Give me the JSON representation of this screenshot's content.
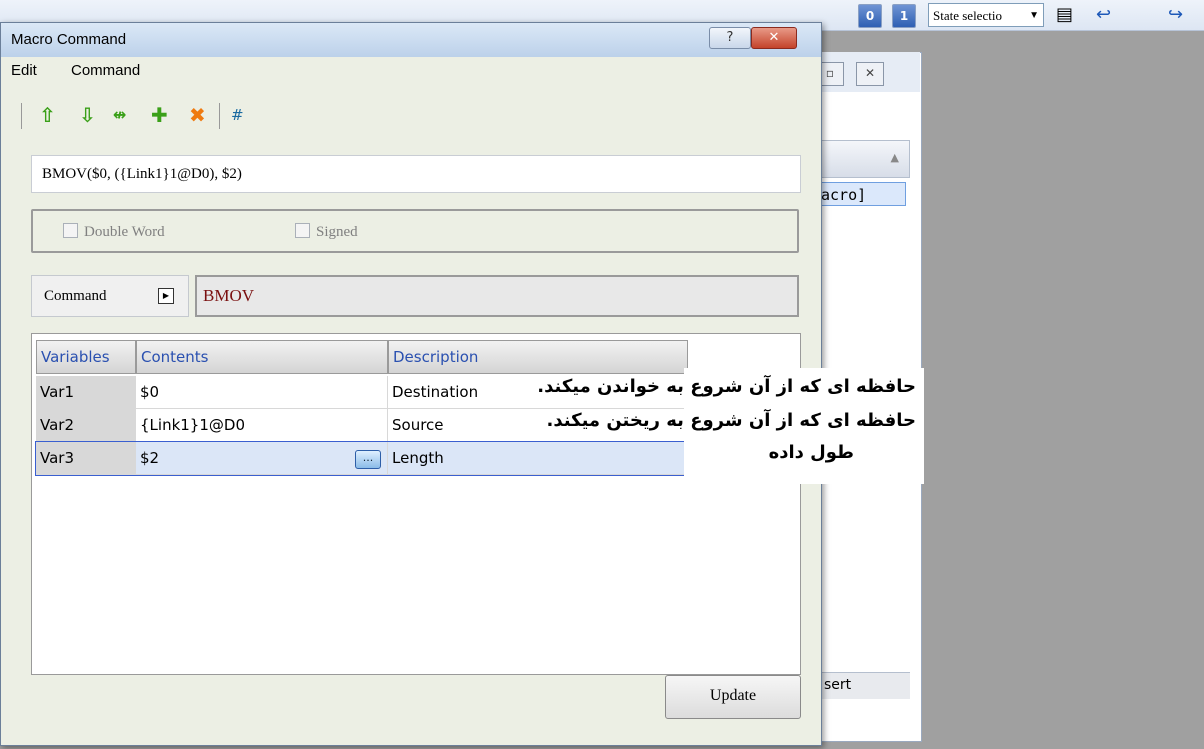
{
  "background": {
    "toolbar_buttons": [
      "0",
      "1"
    ],
    "state_select": "State selectio",
    "panel_list_item": "acro]",
    "status_text": "sert"
  },
  "dialog": {
    "title": "Macro Command",
    "help_label": "?",
    "close_label": "✕",
    "menu": [
      "Edit",
      "Command"
    ],
    "toolbar": {
      "move_up": "⇧",
      "move_down": "⇩",
      "swap": "↮",
      "add": "✚",
      "delete": "✖",
      "number": "#"
    },
    "formula": "BMOV($0, ({Link1}1@D0), $2)",
    "options": {
      "double_word": "Double Word",
      "signed": "Signed"
    },
    "command_label": "Command",
    "command_value": "BMOV",
    "table": {
      "headers": [
        "Variables",
        "Contents",
        "Description"
      ],
      "rows": [
        {
          "var": "Var1",
          "contents": "$0",
          "description": "Destination"
        },
        {
          "var": "Var2",
          "contents": "{Link1}1@D0",
          "description": "Source"
        },
        {
          "var": "Var3",
          "contents": "$2",
          "description": "Length"
        }
      ]
    },
    "update_label": "Update"
  },
  "annotations": [
    "حافظه ای که از آن شروع به خواندن میکند.",
    "حافظه ای که از آن شروع به ریختن میکند.",
    "طول داده"
  ],
  "colors": {
    "header_text": "#2a50b0",
    "command_text": "#7a1010",
    "selection": "#dbe6f7"
  }
}
